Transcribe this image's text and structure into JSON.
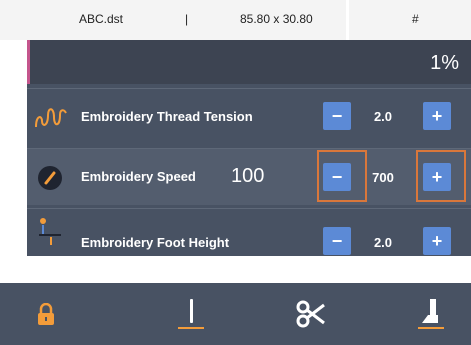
{
  "file": {
    "name": "ABC.dst",
    "separator": "|",
    "size": "85.80 x 30.80",
    "hash": "#"
  },
  "progress": {
    "percent": "1%"
  },
  "rows": [
    {
      "label": "Embroidery Thread Tension",
      "value": "2.0"
    },
    {
      "label": "Embroidery Speed",
      "big_value": "100",
      "value": "700"
    },
    {
      "label": "Embroidery Foot Height",
      "value": "2.0"
    }
  ],
  "controls": {
    "minus": "−",
    "plus": "+"
  },
  "colors": {
    "accent": "#5c8ad6",
    "panel": "#485263",
    "highlight": "#d9773b",
    "icon_orange": "#f39c3a"
  },
  "bottom_bar": {
    "icons": [
      "lock-icon",
      "needle-icon",
      "scissors-icon",
      "presser-foot-icon"
    ]
  }
}
